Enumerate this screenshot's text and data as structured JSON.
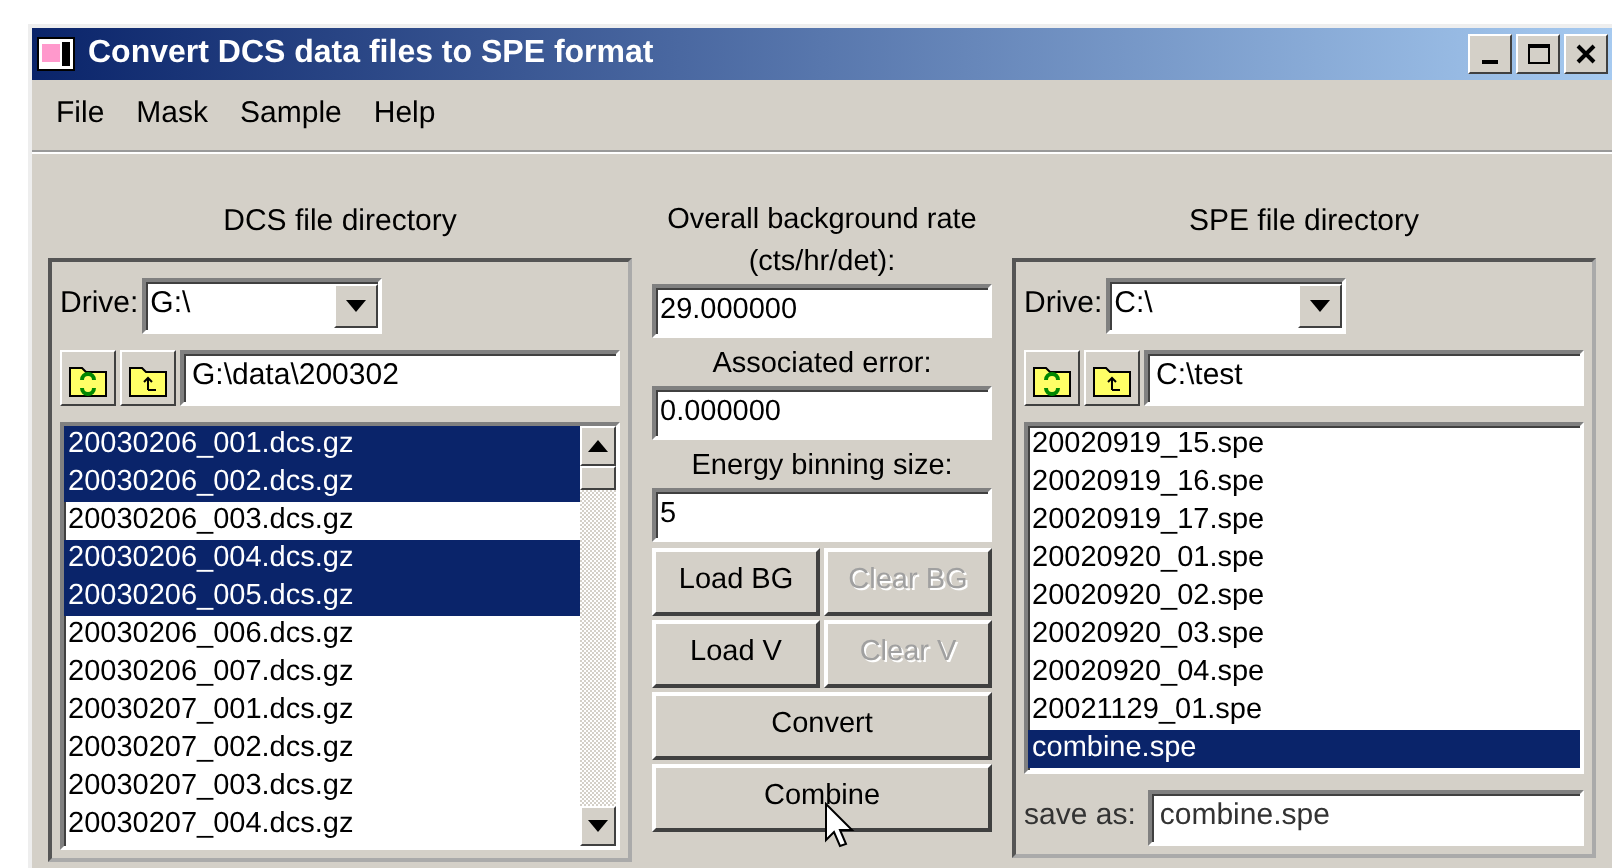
{
  "window": {
    "title": "Convert DCS data files to SPE format"
  },
  "menu": [
    "File",
    "Mask",
    "Sample",
    "Help"
  ],
  "dcs_panel": {
    "title": "DCS file directory",
    "drive_label": "Drive:",
    "drive": "G:\\",
    "path": "G:\\data\\200302",
    "files": [
      {
        "name": "20030206_001.dcs.gz",
        "selected": true
      },
      {
        "name": "20030206_002.dcs.gz",
        "selected": true
      },
      {
        "name": "20030206_003.dcs.gz",
        "selected": false
      },
      {
        "name": "20030206_004.dcs.gz",
        "selected": true
      },
      {
        "name": "20030206_005.dcs.gz",
        "selected": true
      },
      {
        "name": "20030206_006.dcs.gz",
        "selected": false
      },
      {
        "name": "20030206_007.dcs.gz",
        "selected": false
      },
      {
        "name": "20030207_001.dcs.gz",
        "selected": false
      },
      {
        "name": "20030207_002.dcs.gz",
        "selected": false
      },
      {
        "name": "20030207_003.dcs.gz",
        "selected": false
      },
      {
        "name": "20030207_004.dcs.gz",
        "selected": false
      }
    ]
  },
  "settings": {
    "fields": [
      {
        "label": "Overall background rate (cts/hr/det):",
        "value": "29.000000"
      },
      {
        "label": "Associated error:",
        "value": "0.000000"
      },
      {
        "label": "Energy binning size:",
        "value": "5"
      }
    ],
    "buttons": [
      {
        "label": "Load BG",
        "kind": "half",
        "disabled": false
      },
      {
        "label": "Clear BG",
        "kind": "half",
        "disabled": true
      },
      {
        "label": "Load V",
        "kind": "half",
        "disabled": false
      },
      {
        "label": "Clear V",
        "kind": "half",
        "disabled": true
      },
      {
        "label": "Convert",
        "kind": "full",
        "disabled": false
      },
      {
        "label": "Combine",
        "kind": "full",
        "disabled": false
      }
    ]
  },
  "spe_panel": {
    "title": "SPE file directory",
    "drive_label": "Drive:",
    "drive": "C:\\",
    "path": "C:\\test",
    "files": [
      {
        "name": "20020919_15.spe",
        "selected": false
      },
      {
        "name": "20020919_16.spe",
        "selected": false
      },
      {
        "name": "20020919_17.spe",
        "selected": false
      },
      {
        "name": "20020920_01.spe",
        "selected": false
      },
      {
        "name": "20020920_02.spe",
        "selected": false
      },
      {
        "name": "20020920_03.spe",
        "selected": false
      },
      {
        "name": "20020920_04.spe",
        "selected": false
      },
      {
        "name": "20021129_01.spe",
        "selected": false
      },
      {
        "name": "combine.spe",
        "selected": true
      }
    ],
    "save_label": "save as:",
    "save_value": "combine.spe"
  }
}
